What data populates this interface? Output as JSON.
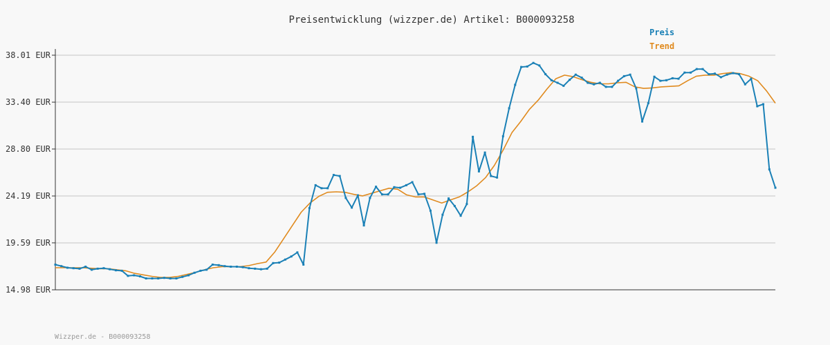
{
  "chart_data": {
    "type": "line",
    "title": "Preisentwicklung (wizzper.de) Artikel: B000093258",
    "footer": "Wizzper.de - B000093258",
    "ylim": [
      14.98,
      38.01
    ],
    "yticks": [
      "38.01 EUR",
      "33.40 EUR",
      "28.80 EUR",
      "24.19 EUR",
      "19.59 EUR",
      "14.98 EUR"
    ],
    "ytick_values": [
      38.01,
      33.4,
      28.8,
      24.19,
      19.59,
      14.98
    ],
    "grid": true,
    "legend_position": "top-right",
    "series": [
      {
        "name": "Preis",
        "color": "#1a80b6",
        "values": [
          17.45,
          17.3,
          17.15,
          17.1,
          17.05,
          17.25,
          16.95,
          17.05,
          17.1,
          17.0,
          16.9,
          16.85,
          16.35,
          16.4,
          16.3,
          16.1,
          16.1,
          16.1,
          16.15,
          16.1,
          16.1,
          16.25,
          16.4,
          16.65,
          16.85,
          16.95,
          17.45,
          17.4,
          17.3,
          17.25,
          17.25,
          17.2,
          17.1,
          17.05,
          17.0,
          17.05,
          17.6,
          17.65,
          17.95,
          18.25,
          18.65,
          17.45,
          23.0,
          25.25,
          24.95,
          24.95,
          26.25,
          26.15,
          24.0,
          23.05,
          24.25,
          21.3,
          24.0,
          25.1,
          24.35,
          24.35,
          25.05,
          25.0,
          25.25,
          25.55,
          24.35,
          24.4,
          22.75,
          19.6,
          22.35,
          23.95,
          23.2,
          22.25,
          23.4,
          30.0,
          26.6,
          28.45,
          26.15,
          26.0,
          30.05,
          32.8,
          35.1,
          36.85,
          36.9,
          37.25,
          37.0,
          36.15,
          35.55,
          35.3,
          35.0,
          35.6,
          36.1,
          35.8,
          35.3,
          35.15,
          35.3,
          34.9,
          34.9,
          35.5,
          35.95,
          36.1,
          34.75,
          31.5,
          33.3,
          35.9,
          35.5,
          35.55,
          35.75,
          35.7,
          36.3,
          36.3,
          36.65,
          36.65,
          36.15,
          36.2,
          35.85,
          36.1,
          36.25,
          36.15,
          35.15,
          35.7,
          33.0,
          33.2,
          26.8,
          25.0
        ]
      },
      {
        "name": "Trend",
        "color": "#e08a1e",
        "values": [
          17.15,
          17.15,
          17.15,
          17.15,
          17.1,
          17.05,
          17.05,
          16.95,
          16.85,
          16.6,
          16.45,
          16.3,
          16.2,
          16.2,
          16.3,
          16.5,
          16.7,
          16.95,
          17.15,
          17.25,
          17.25,
          17.25,
          17.35,
          17.55,
          17.7,
          18.7,
          20.0,
          21.3,
          22.6,
          23.5,
          24.15,
          24.55,
          24.6,
          24.55,
          24.35,
          24.2,
          24.45,
          24.7,
          24.95,
          24.85,
          24.3,
          24.1,
          24.1,
          23.8,
          23.5,
          23.8,
          24.1,
          24.6,
          25.2,
          26.0,
          27.2,
          28.7,
          30.4,
          31.5,
          32.7,
          33.6,
          34.7,
          35.7,
          36.05,
          35.9,
          35.6,
          35.35,
          35.2,
          35.2,
          35.3,
          35.35,
          34.9,
          34.75,
          34.8,
          34.9,
          34.95,
          35.0,
          35.5,
          35.95,
          36.05,
          36.05,
          36.2,
          36.3,
          36.2,
          35.95,
          35.5,
          34.5,
          33.3
        ]
      }
    ]
  },
  "colors": {
    "background": "#f8f8f8",
    "grid": "#dedede",
    "axis": "#333333",
    "text": "#333333",
    "footer": "#999999"
  }
}
